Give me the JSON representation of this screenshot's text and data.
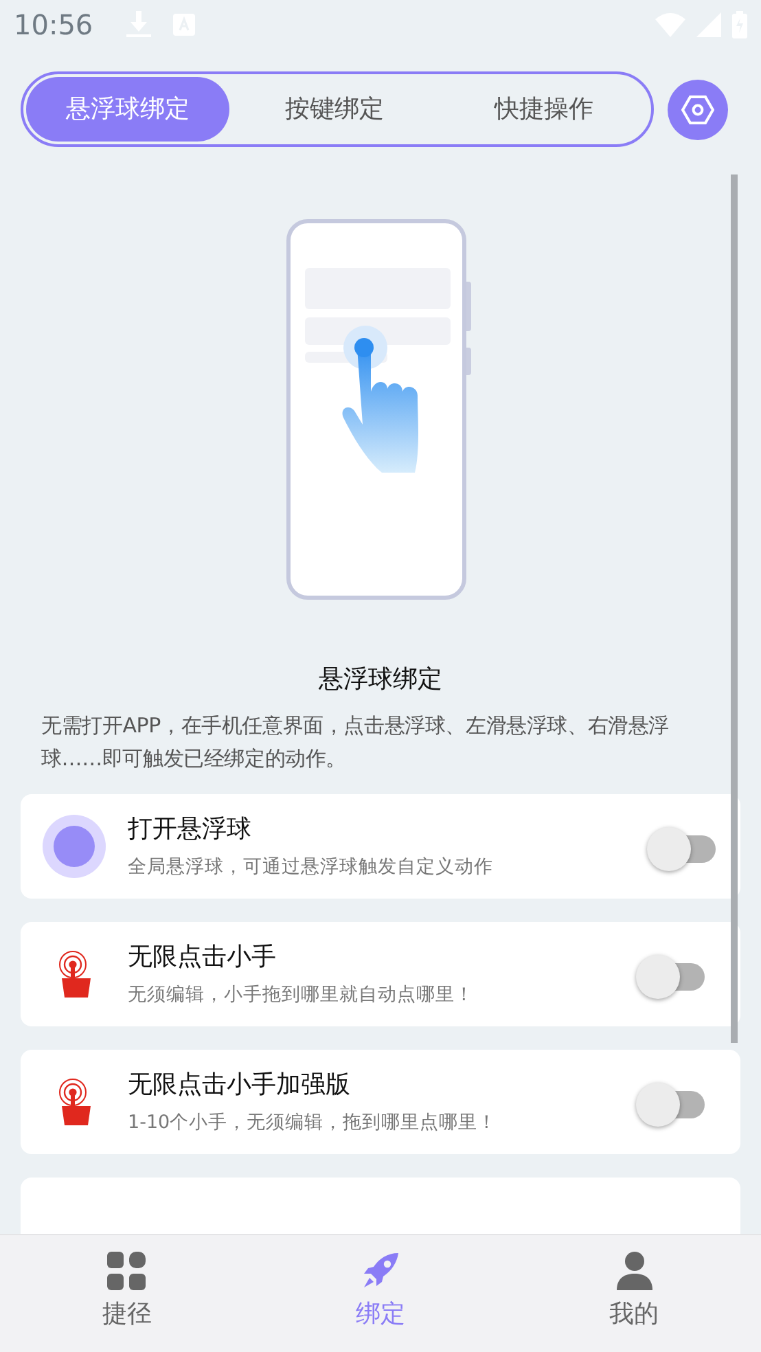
{
  "status_bar": {
    "time": "10:56"
  },
  "tabs": [
    {
      "label": "悬浮球绑定",
      "selected": true
    },
    {
      "label": "按键绑定",
      "selected": false
    },
    {
      "label": "快捷操作",
      "selected": false
    }
  ],
  "intro": {
    "title": "悬浮球绑定",
    "description": "无需打开APP，在手机任意界面，点击悬浮球、左滑悬浮球、右滑悬浮球……即可触发已经绑定的动作。"
  },
  "features": [
    {
      "kind": "ball",
      "title": "打开悬浮球",
      "subtitle": "全局悬浮球，可通过悬浮球触发自定义动作",
      "on": false
    },
    {
      "kind": "hand",
      "title": "无限点击小手",
      "subtitle": "无须编辑，小手拖到哪里就自动点哪里！",
      "on": false
    },
    {
      "kind": "hand",
      "title": "无限点击小手加强版",
      "subtitle": "1-10个小手，无须编辑，拖到哪里点哪里！",
      "on": false
    },
    {
      "kind": "partial"
    }
  ],
  "bottom_nav": [
    {
      "kind": "grid",
      "label": "捷径",
      "selected": false
    },
    {
      "kind": "rocket",
      "label": "绑定",
      "selected": true
    },
    {
      "kind": "person",
      "label": "我的",
      "selected": false
    }
  ]
}
